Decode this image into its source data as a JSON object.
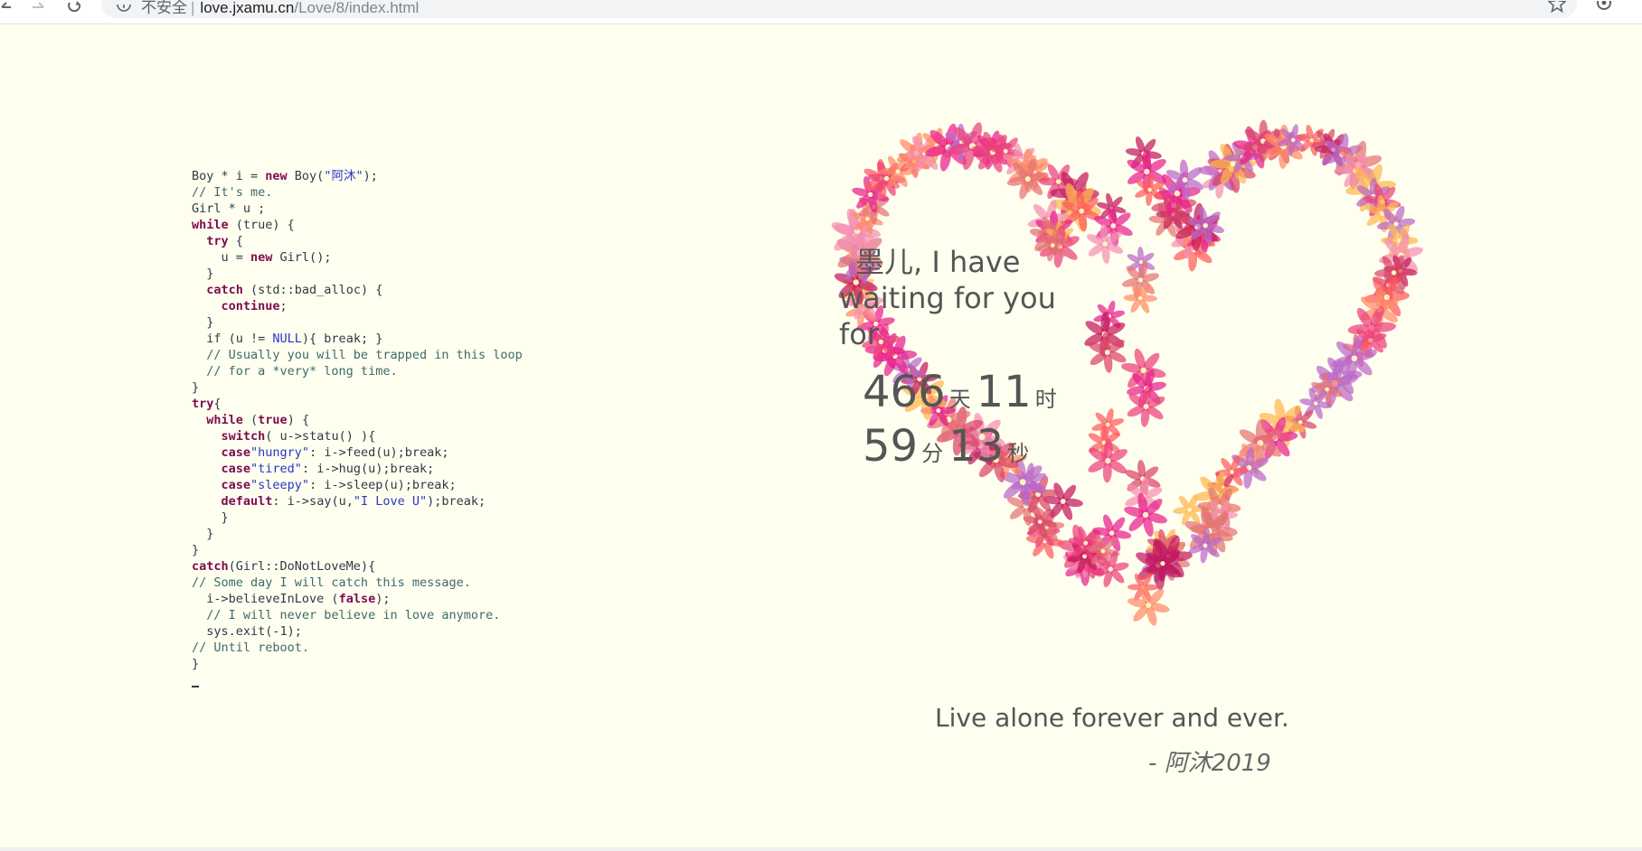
{
  "browser": {
    "security_label": "不安全",
    "separator": "|",
    "url_host": "love.jxamu.cn",
    "url_path": "/Love/8/index.html",
    "icons": [
      "back-icon",
      "forward-icon",
      "reload-icon",
      "info-icon",
      "star-icon",
      "extension-icon"
    ]
  },
  "code": {
    "lines": [
      [
        {
          "t": "Boy * i = ",
          "c": ""
        },
        {
          "t": "new",
          "c": "kw"
        },
        {
          "t": " Boy(",
          "c": ""
        },
        {
          "t": "\"阿沐\"",
          "c": "str"
        },
        {
          "t": ");",
          "c": ""
        }
      ],
      [
        {
          "t": "// It's me.",
          "c": "cm"
        }
      ],
      [
        {
          "t": "Girl * u ;",
          "c": ""
        }
      ],
      [
        {
          "t": "while",
          "c": "kw"
        },
        {
          "t": " (true) {",
          "c": ""
        }
      ],
      [
        {
          "t": "  ",
          "c": ""
        },
        {
          "t": "try",
          "c": "kw"
        },
        {
          "t": " {",
          "c": ""
        }
      ],
      [
        {
          "t": "    u = ",
          "c": ""
        },
        {
          "t": "new",
          "c": "kw"
        },
        {
          "t": " Girl();",
          "c": ""
        }
      ],
      [
        {
          "t": "  }",
          "c": ""
        }
      ],
      [
        {
          "t": "  ",
          "c": ""
        },
        {
          "t": "catch",
          "c": "kw"
        },
        {
          "t": " (std::bad_alloc) {",
          "c": ""
        }
      ],
      [
        {
          "t": "    ",
          "c": ""
        },
        {
          "t": "continue",
          "c": "kw"
        },
        {
          "t": ";",
          "c": ""
        }
      ],
      [
        {
          "t": "  }",
          "c": ""
        }
      ],
      [
        {
          "t": "  if (u != ",
          "c": ""
        },
        {
          "t": "NULL",
          "c": "nul"
        },
        {
          "t": "){ break; }",
          "c": ""
        }
      ],
      [
        {
          "t": "  // Usually you will be trapped in this loop",
          "c": "cm"
        }
      ],
      [
        {
          "t": "  // for a *very* long time.",
          "c": "cm"
        }
      ],
      [
        {
          "t": "}",
          "c": ""
        }
      ],
      [
        {
          "t": "try",
          "c": "kw"
        },
        {
          "t": "{",
          "c": ""
        }
      ],
      [
        {
          "t": "  ",
          "c": ""
        },
        {
          "t": "while",
          "c": "kw"
        },
        {
          "t": " (",
          "c": ""
        },
        {
          "t": "true",
          "c": "kw"
        },
        {
          "t": ") {",
          "c": ""
        }
      ],
      [
        {
          "t": "    ",
          "c": ""
        },
        {
          "t": "switch",
          "c": "kw"
        },
        {
          "t": "( u->statu() ){",
          "c": ""
        }
      ],
      [
        {
          "t": "    ",
          "c": ""
        },
        {
          "t": "case",
          "c": "kw"
        },
        {
          "t": "\"hungry\"",
          "c": "str"
        },
        {
          "t": ": i->feed(u);break;",
          "c": ""
        }
      ],
      [
        {
          "t": "    ",
          "c": ""
        },
        {
          "t": "case",
          "c": "kw"
        },
        {
          "t": "\"tired\"",
          "c": "str"
        },
        {
          "t": ": i->hug(u);break;",
          "c": ""
        }
      ],
      [
        {
          "t": "    ",
          "c": ""
        },
        {
          "t": "case",
          "c": "kw"
        },
        {
          "t": "\"sleepy\"",
          "c": "str"
        },
        {
          "t": ": i->sleep(u);break;",
          "c": ""
        }
      ],
      [
        {
          "t": "    ",
          "c": ""
        },
        {
          "t": "default",
          "c": "kw"
        },
        {
          "t": ": i->say(u,",
          "c": ""
        },
        {
          "t": "\"I Love U\"",
          "c": "str"
        },
        {
          "t": ");break;",
          "c": ""
        }
      ],
      [
        {
          "t": "    }",
          "c": ""
        }
      ],
      [
        {
          "t": "  }",
          "c": ""
        }
      ],
      [
        {
          "t": "}",
          "c": ""
        }
      ],
      [
        {
          "t": "catch",
          "c": "kw"
        },
        {
          "t": "(Girl::DoNotLoveMe){",
          "c": ""
        }
      ],
      [
        {
          "t": "// Some day I will catch this message.",
          "c": "cm"
        }
      ],
      [
        {
          "t": "  i->believeInLove (",
          "c": ""
        },
        {
          "t": "false",
          "c": "kw"
        },
        {
          "t": ");",
          "c": ""
        }
      ],
      [
        {
          "t": "  // I will never believe in love anymore.",
          "c": "cm"
        }
      ],
      [
        {
          "t": "  sys.exit(-1);",
          "c": ""
        }
      ],
      [
        {
          "t": "// Until reboot.",
          "c": "cm"
        }
      ],
      [
        {
          "t": "}",
          "c": ""
        }
      ]
    ]
  },
  "message": {
    "line1": "墨儿, I have",
    "line2": "waiting for you",
    "line3": "for"
  },
  "counter": {
    "days": "466",
    "days_unit": "天",
    "hours": "11",
    "hours_unit": "时",
    "minutes": "59",
    "minutes_unit": "分",
    "seconds": "13",
    "seconds_unit": "秒"
  },
  "quote": "Live alone forever and ever.",
  "signature": "- 阿沐2019",
  "colors": {
    "background": "#fffff0",
    "text": "#555555",
    "keyword": "#7b0c4e",
    "string": "#2a36c6",
    "comment": "#3c6a6a",
    "flowers": [
      "#e91e8c",
      "#ff5a5a",
      "#d94466",
      "#ff8a65",
      "#c2185b",
      "#f48fb1",
      "#e57373",
      "#ba68c8",
      "#ffb74d",
      "#ec407a"
    ]
  }
}
